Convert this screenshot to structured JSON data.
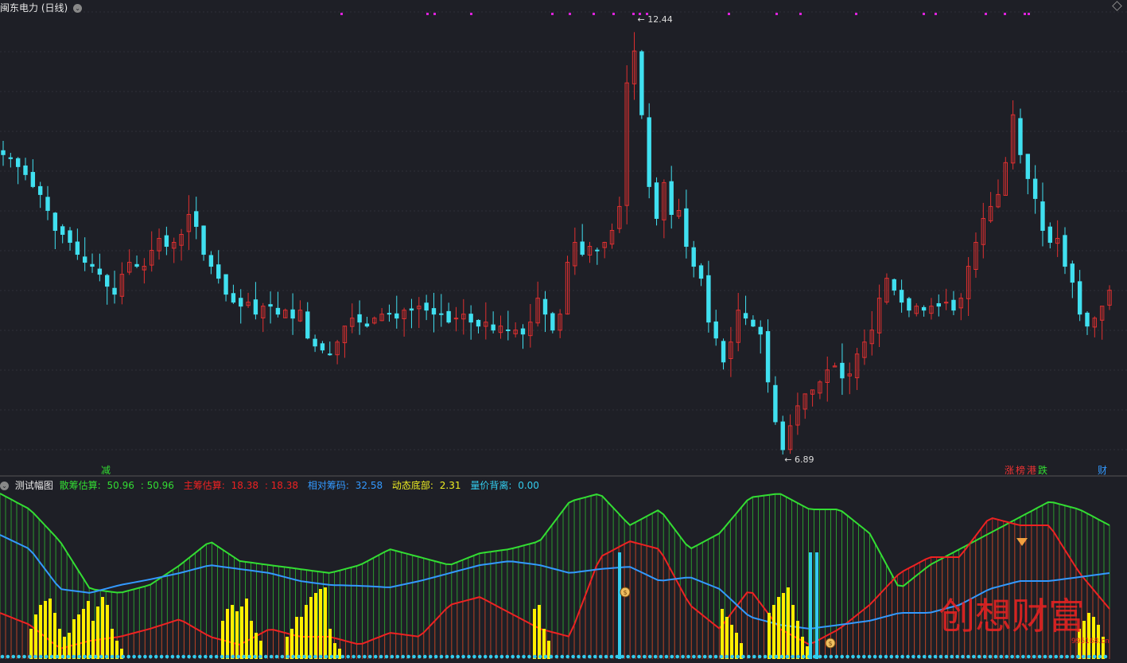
{
  "header": {
    "title": "闽东电力",
    "period": "(日线)"
  },
  "price_panel": {
    "high_label": "12.44",
    "low_label": "6.89",
    "signal_left": "减",
    "signals_right": [
      "涨",
      "榜",
      "港",
      "跌"
    ],
    "signal_far_right": "财"
  },
  "indicator": {
    "name": "测试幅图",
    "items": [
      {
        "label": "散筹估算:",
        "value": "50.96",
        "value2": "50.96",
        "color": "#33dd33"
      },
      {
        "label": "主筹估算:",
        "value": "18.38",
        "value2": "18.38",
        "color": "#ee2222"
      },
      {
        "label": "相对筹码:",
        "value": "32.58",
        "color": "#3399ff"
      },
      {
        "label": "动态底部:",
        "value": "2.31",
        "color": "#eeee22"
      },
      {
        "label": "量价背离:",
        "value": "0.00",
        "color": "#33ccee"
      }
    ]
  },
  "watermark": {
    "text": "创想财富",
    "sub": "995168.cn"
  },
  "colors": {
    "background": "#1e1f26",
    "up": "#e03030",
    "down": "#40e0f0",
    "green_line": "#33dd33",
    "red_line": "#ee2222",
    "blue_line": "#3399ff",
    "yellow_bar": "#ffee00",
    "cyan_bar": "#33ccee",
    "magenta_dot": "#dd22dd"
  },
  "chart_data": {
    "type": "candlestick",
    "ylim": [
      6.89,
      12.44
    ],
    "candles_close": [
      10.7,
      10.65,
      10.55,
      10.45,
      10.3,
      10.2,
      10.0,
      9.75,
      9.7,
      9.6,
      9.45,
      9.35,
      9.3,
      9.2,
      9.05,
      8.95,
      9.2,
      9.35,
      9.3,
      9.3,
      9.5,
      9.65,
      9.55,
      9.6,
      9.7,
      9.95,
      9.8,
      9.45,
      9.3,
      9.15,
      8.95,
      8.85,
      8.8,
      8.85,
      8.7,
      8.8,
      8.8,
      8.7,
      8.75,
      8.65,
      8.75,
      8.4,
      8.3,
      8.25,
      8.2,
      8.35,
      8.55,
      8.65,
      8.6,
      8.55,
      8.65,
      8.7,
      8.7,
      8.65,
      8.75,
      8.75,
      8.8,
      8.75,
      8.7,
      8.7,
      8.6,
      8.65,
      8.7,
      8.6,
      8.55,
      8.6,
      8.5,
      8.55,
      8.5,
      8.5,
      8.45,
      8.6,
      8.9,
      8.7,
      8.5,
      8.7,
      9.35,
      9.6,
      9.45,
      9.55,
      9.5,
      9.6,
      9.75,
      10.05,
      11.6,
      12.0,
      11.2,
      10.3,
      9.9,
      10.35,
      9.95,
      10.0,
      9.55,
      9.3,
      9.15,
      8.6,
      8.4,
      8.1,
      8.35,
      8.75,
      8.65,
      8.55,
      8.45,
      7.85,
      7.35,
      7.0,
      7.3,
      7.55,
      7.7,
      7.75,
      7.85,
      8.0,
      8.05,
      7.9,
      7.95,
      8.2,
      8.35,
      8.5,
      8.9,
      9.15,
      9.0,
      8.85,
      8.75,
      8.8,
      8.75,
      8.8,
      8.8,
      8.85,
      8.75,
      8.9,
      9.3,
      9.6,
      9.9,
      10.05,
      10.2,
      10.6,
      11.2,
      10.7,
      10.4,
      10.15,
      9.75,
      9.6,
      9.65,
      9.3,
      9.1,
      8.7,
      8.55,
      8.65,
      8.8,
      9.0
    ]
  }
}
